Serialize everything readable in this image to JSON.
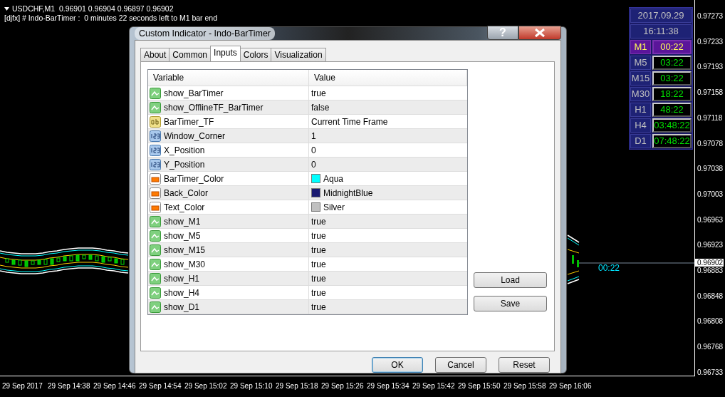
{
  "chart": {
    "header": "USDCHF,M1  0.96901 0.96904 0.96897 0.96902",
    "indicator_line": "[djfx] # Indo-BarTimer :  0 minutes 22 seconds left to M1 bar end",
    "timer_label": "00:22",
    "price_axis": [
      "0.97273",
      "0.97233",
      "0.97193",
      "0.97158",
      "0.97118",
      "0.97078",
      "0.97038",
      "0.97003",
      "0.96963",
      "0.96923",
      "0.96883",
      "0.96848",
      "0.96808",
      "0.96768",
      "0.96733"
    ],
    "current_price": "0.96902",
    "time_axis": [
      "29 Sep 2017",
      "29 Sep 14:38",
      "29 Sep 14:46",
      "29 Sep 14:54",
      "29 Sep 15:02",
      "29 Sep 15:10",
      "29 Sep 15:18",
      "29 Sep 15:26",
      "29 Sep 15:34",
      "29 Sep 15:42",
      "29 Sep 15:50",
      "29 Sep 15:58",
      "29 Sep 16:06"
    ]
  },
  "timer_panel": {
    "date": "2017.09.29",
    "time": "16:11:38",
    "rows": [
      {
        "tf": "M1",
        "left": "00:22",
        "selected": true
      },
      {
        "tf": "M5",
        "left": "03:22",
        "selected": false
      },
      {
        "tf": "M15",
        "left": "03:22",
        "selected": false
      },
      {
        "tf": "M30",
        "left": "18:22",
        "selected": false
      },
      {
        "tf": "H1",
        "left": "48:22",
        "selected": false
      },
      {
        "tf": "H4",
        "left": "03:48:22",
        "selected": false
      },
      {
        "tf": "D1",
        "left": "07:48:22",
        "selected": false
      }
    ]
  },
  "dialog": {
    "title": "Custom Indicator - Indo-BarTimer",
    "help": "?",
    "tabs": [
      {
        "label": "About",
        "selected": false
      },
      {
        "label": "Common",
        "selected": false
      },
      {
        "label": "Inputs",
        "selected": true
      },
      {
        "label": "Colors",
        "selected": false
      },
      {
        "label": "Visualization",
        "selected": false
      }
    ],
    "table": {
      "columns": [
        "Variable",
        "Value"
      ],
      "rows": [
        {
          "kind": "bool",
          "variable": "show_BarTimer",
          "value": "true"
        },
        {
          "kind": "bool",
          "variable": "show_OfflineTF_BarTimer",
          "value": "false"
        },
        {
          "kind": "string",
          "variable": "BarTimer_TF",
          "value": "Current Time Frame"
        },
        {
          "kind": "int",
          "variable": "Window_Corner",
          "value": "1"
        },
        {
          "kind": "int",
          "variable": "X_Position",
          "value": "0"
        },
        {
          "kind": "int",
          "variable": "Y_Position",
          "value": "0"
        },
        {
          "kind": "color",
          "variable": "BarTimer_Color",
          "value": "Aqua",
          "color": "#00ffff"
        },
        {
          "kind": "color",
          "variable": "Back_Color",
          "value": "MidnightBlue",
          "color": "#191970"
        },
        {
          "kind": "color",
          "variable": "Text_Color",
          "value": "Silver",
          "color": "#c0c0c0"
        },
        {
          "kind": "bool",
          "variable": "show_M1",
          "value": "true"
        },
        {
          "kind": "bool",
          "variable": "show_M5",
          "value": "true"
        },
        {
          "kind": "bool",
          "variable": "show_M15",
          "value": "true"
        },
        {
          "kind": "bool",
          "variable": "show_M30",
          "value": "true"
        },
        {
          "kind": "bool",
          "variable": "show_H1",
          "value": "true"
        },
        {
          "kind": "bool",
          "variable": "show_H4",
          "value": "true"
        },
        {
          "kind": "bool",
          "variable": "show_D1",
          "value": "true"
        }
      ]
    },
    "side_buttons": [
      "Load",
      "Save"
    ],
    "buttons": [
      "OK",
      "Cancel",
      "Reset"
    ]
  }
}
